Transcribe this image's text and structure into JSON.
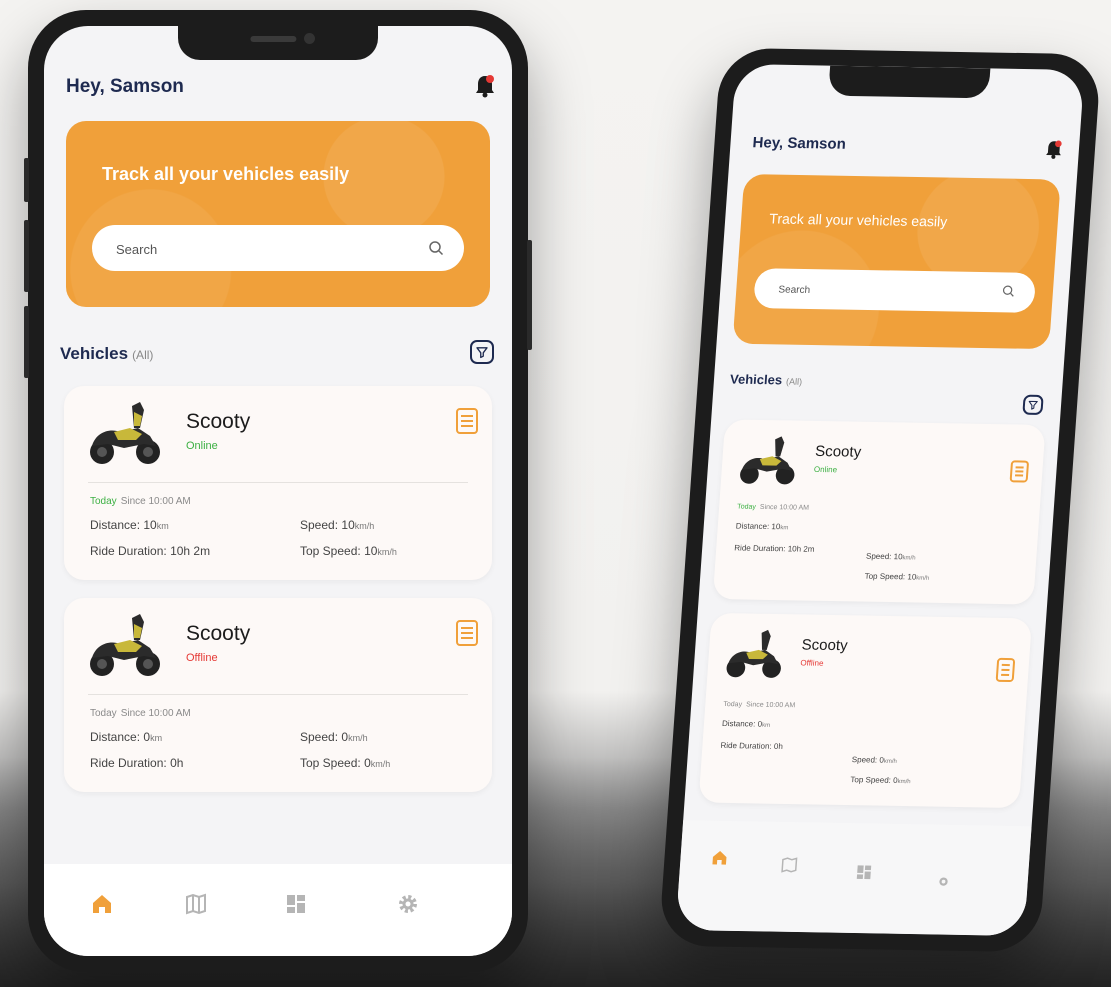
{
  "app": {
    "greeting": "Hey, Samson",
    "banner_title": "Track all your vehicles easily",
    "search_placeholder": "Search",
    "section_title": "Vehicles",
    "section_filter_label": "(All)"
  },
  "colors": {
    "accent": "#f0a03a",
    "navy": "#1e2a50",
    "online": "#3cb043",
    "offline": "#e53935"
  },
  "vehicles": [
    {
      "name": "Scooty",
      "status": "Online",
      "today_label": "Today",
      "since": "Since 10:00 AM",
      "distance_label": "Distance:",
      "distance_value": "10",
      "distance_unit": "km",
      "speed_label": "Speed:",
      "speed_value": "10",
      "speed_unit": "km/h",
      "duration_label": "Ride Duration:",
      "duration_value": "10h 2m",
      "top_speed_label": "Top Speed:",
      "top_speed_value": "10",
      "top_speed_unit": "km/h"
    },
    {
      "name": "Scooty",
      "status": "Offline",
      "today_label": "Today",
      "since": "Since 10:00 AM",
      "distance_label": "Distance:",
      "distance_value": "0",
      "distance_unit": "km",
      "speed_label": "Speed:",
      "speed_value": "0",
      "speed_unit": "km/h",
      "duration_label": "Ride Duration:",
      "duration_value": "0h",
      "top_speed_label": "Top Speed:",
      "top_speed_value": "0",
      "top_speed_unit": "km/h"
    }
  ],
  "tabs": [
    {
      "icon": "home-icon",
      "active": true
    },
    {
      "icon": "map-icon",
      "active": false
    },
    {
      "icon": "dashboard-icon",
      "active": false
    },
    {
      "icon": "settings-icon",
      "active": false
    }
  ]
}
